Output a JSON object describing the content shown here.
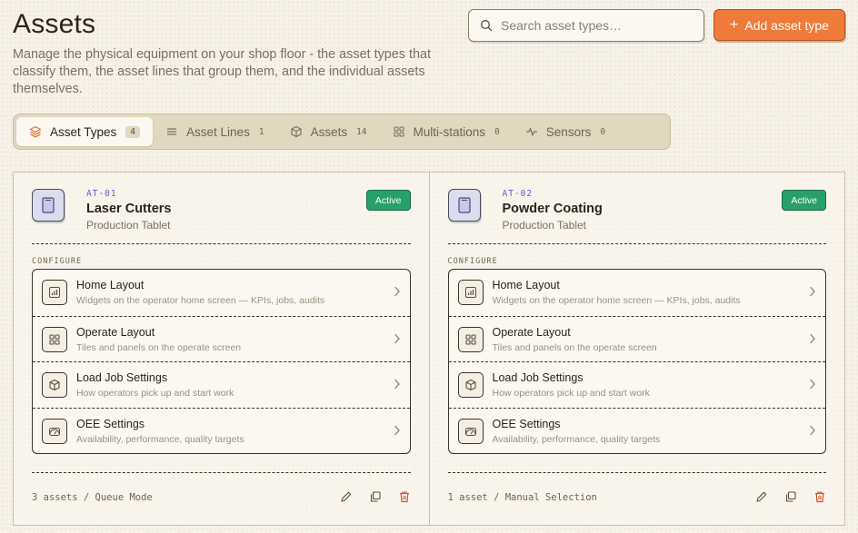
{
  "header": {
    "title": "Assets",
    "subtitle": "Manage the physical equipment on your shop floor - the asset types that classify them, the asset lines that group them, and the individual assets themselves."
  },
  "search": {
    "placeholder": "Search asset types…",
    "value": ""
  },
  "add_button": {
    "label": "Add asset type",
    "icon": "plus-icon"
  },
  "tabs": [
    {
      "label": "Asset Types",
      "count": "4",
      "icon": "layers-icon",
      "active": true
    },
    {
      "label": "Asset Lines",
      "count": "1",
      "icon": "list-icon",
      "active": false
    },
    {
      "label": "Assets",
      "count": "14",
      "icon": "cube-icon",
      "active": false
    },
    {
      "label": "Multi-stations",
      "count": "0",
      "icon": "grid-icon",
      "active": false
    },
    {
      "label": "Sensors",
      "count": "0",
      "icon": "pulse-icon",
      "active": false
    }
  ],
  "colors": {
    "accent": "#f07a3a",
    "active_badge": "#27a06a",
    "code_text": "#5b5bd6"
  },
  "cards": [
    {
      "code": "AT-01",
      "name": "Laser Cutters",
      "device": "Production Tablet",
      "status": "Active",
      "configure_label": "CONFIGURE",
      "config_items": [
        {
          "title": "Home Layout",
          "desc": "Widgets on the operator home screen — KPIs, jobs, audits",
          "icon": "bar-chart-icon"
        },
        {
          "title": "Operate Layout",
          "desc": "Tiles and panels on the operate screen",
          "icon": "grid-icon"
        },
        {
          "title": "Load Job Settings",
          "desc": "How operators pick up and start work",
          "icon": "box-icon"
        },
        {
          "title": "OEE Settings",
          "desc": "Availability, performance, quality targets",
          "icon": "gauge-icon"
        }
      ],
      "footer": "3 assets / Queue Mode"
    },
    {
      "code": "AT-02",
      "name": "Powder Coating",
      "device": "Production Tablet",
      "status": "Active",
      "configure_label": "CONFIGURE",
      "config_items": [
        {
          "title": "Home Layout",
          "desc": "Widgets on the operator home screen — KPIs, jobs, audits",
          "icon": "bar-chart-icon"
        },
        {
          "title": "Operate Layout",
          "desc": "Tiles and panels on the operate screen",
          "icon": "grid-icon"
        },
        {
          "title": "Load Job Settings",
          "desc": "How operators pick up and start work",
          "icon": "box-icon"
        },
        {
          "title": "OEE Settings",
          "desc": "Availability, performance, quality targets",
          "icon": "gauge-icon"
        }
      ],
      "footer": "1 asset / Manual Selection"
    }
  ]
}
